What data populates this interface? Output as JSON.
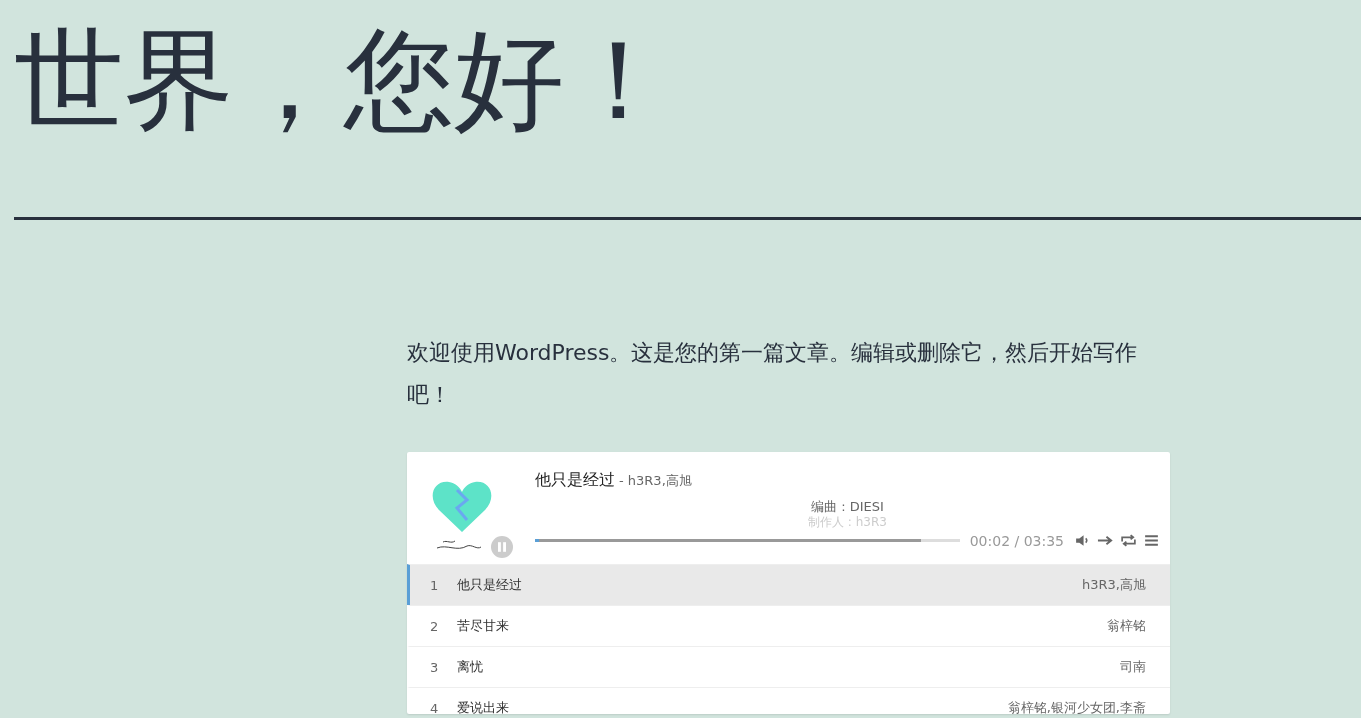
{
  "heading": "世界，您好！",
  "paragraph": "欢迎使用WordPress。这是您的第一篇文章。编辑或删除它，然后开始写作吧！",
  "player": {
    "title": "他只是经过",
    "artist": "- h3R3,高旭",
    "lyrics": [
      "编曲 : DIESI",
      "制作人 : h3R3"
    ],
    "playing": true,
    "level": 0.01,
    "time": "00:02 / 03:35",
    "playlist": [
      {
        "number": "1",
        "title": "他只是经过",
        "artist": "h3R3,高旭",
        "selected": true
      },
      {
        "number": "2",
        "title": "苦尽甘来",
        "artist": "翁梓铭",
        "selected": false
      },
      {
        "number": "3",
        "title": "离忧",
        "artist": "司南",
        "selected": false
      },
      {
        "number": "4",
        "title": "爱说出来",
        "artist": "翁梓铭,银河少女团,李斋",
        "selected": false
      }
    ]
  }
}
